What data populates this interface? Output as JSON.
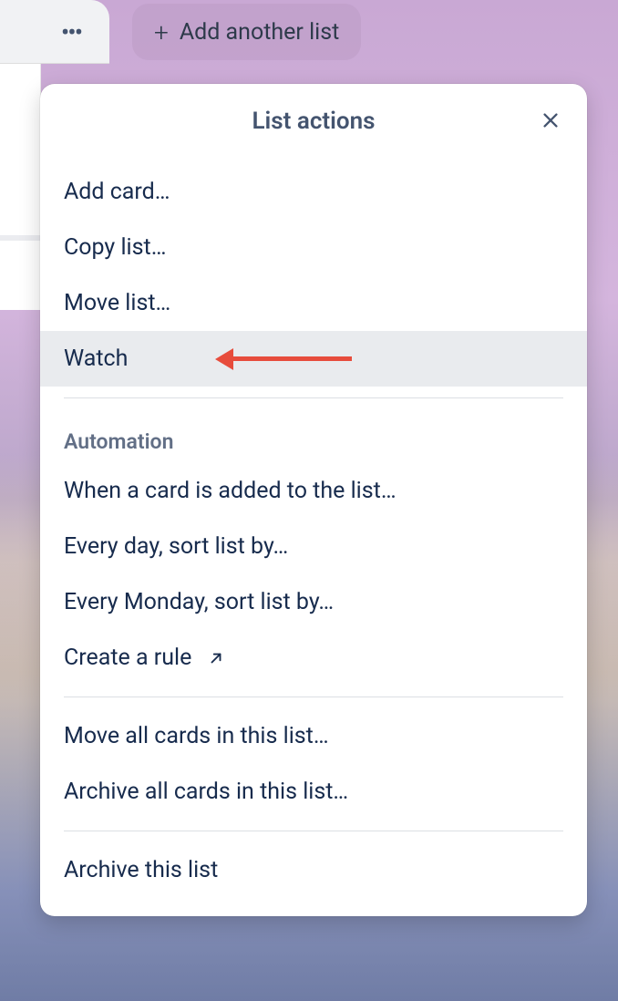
{
  "board": {
    "add_list_label": "Add another list"
  },
  "popover": {
    "title": "List actions",
    "items": {
      "add_card": "Add card…",
      "copy_list": "Copy list…",
      "move_list": "Move list…",
      "watch": "Watch"
    },
    "automation": {
      "header": "Automation",
      "when_card_added": "When a card is added to the list…",
      "every_day_sort": "Every day, sort list by…",
      "every_monday_sort": "Every Monday, sort list by…",
      "create_rule": "Create a rule"
    },
    "bulk": {
      "move_all": "Move all cards in this list…",
      "archive_all": "Archive all cards in this list…"
    },
    "archive_list": "Archive this list"
  }
}
